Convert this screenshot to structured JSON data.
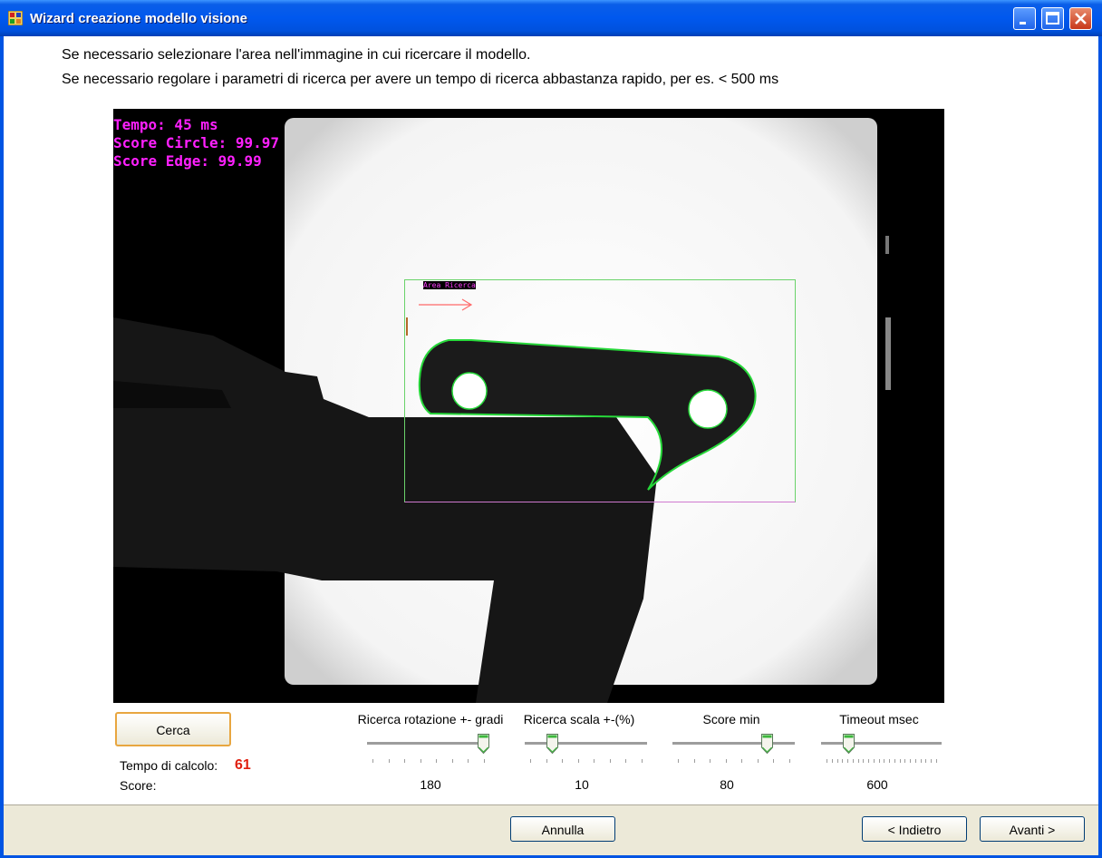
{
  "window": {
    "title": "Wizard creazione modello visione",
    "title_color": "#0054e3"
  },
  "instructions": [
    "Se necessario selezionare l'area nell'immagine in cui ricercare il modello.",
    "Se necessario regolare i parametri di ricerca per avere un tempo di ricerca abbastanza rapido, per es. < 500 ms"
  ],
  "image_overlay": {
    "lines": [
      "Tempo: 45 ms",
      "Score Circle: 99.97",
      "Score Edge: 99.99"
    ],
    "roi_label": "Area Ricerca",
    "overlay_color": "#ff20ff"
  },
  "search_button": {
    "label": "Cerca"
  },
  "stats": {
    "calc_time_label": "Tempo di calcolo:",
    "calc_time_value": "61",
    "score_label": "Score:"
  },
  "sliders": [
    {
      "title": "Ricerca rotazione +-  gradi",
      "value": "180",
      "level": 1.0
    },
    {
      "title": "Ricerca scala +-(%)",
      "value": "10",
      "level": 0.2
    },
    {
      "title": "Score min",
      "value": "80",
      "level": 0.8
    },
    {
      "title": "Timeout msec",
      "value": "600",
      "level": 0.2
    }
  ],
  "footer": {
    "cancel_label": "Annulla",
    "back_label": "< Indietro",
    "next_label": "Avanti >"
  }
}
